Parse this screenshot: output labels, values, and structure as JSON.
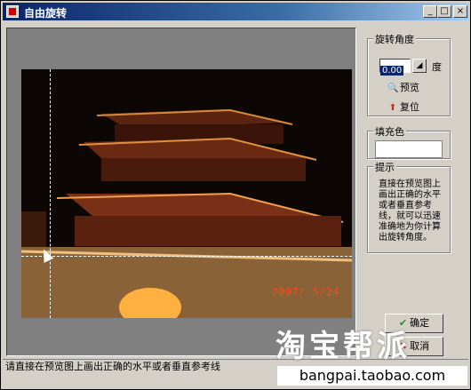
{
  "window": {
    "title": "自由旋转",
    "min_glyph": "_",
    "max_glyph": "□",
    "close_glyph": "×"
  },
  "rotate_group": {
    "label": "旋转角度",
    "angle_value": "0.00",
    "unit": "度",
    "preview_label": "预览",
    "reset_label": "复位"
  },
  "fill_group": {
    "label": "填充色",
    "color": "#ffffff"
  },
  "hint_group": {
    "label": "提示",
    "text": "直接在预览图上画出正确的水平或者垂直参考线，就可以迅速准确地为你计算出旋转角度。"
  },
  "photo": {
    "date_stamp": "2007/ 5/24"
  },
  "buttons": {
    "ok_label": "确定",
    "cancel_label": "取消"
  },
  "status": {
    "text": "请直接在预览图上画出正确的水平或者垂直参考线"
  },
  "watermark": {
    "logo_text": "淘宝帮派",
    "url": "bangpai.taobao.com"
  }
}
